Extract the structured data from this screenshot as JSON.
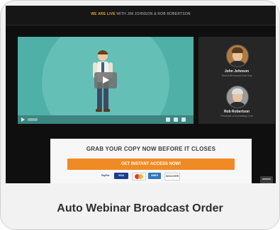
{
  "card": {
    "title": "Auto Webinar Broadcast Order"
  },
  "preview": {
    "topbar": {
      "live_label": "WE ARE LIVE",
      "live_rest": " WITH JIM JOHNSON & ROB ROBERTSON"
    },
    "video": {
      "icon": "play-icon"
    },
    "hosts": [
      {
        "name": "John Johnson",
        "role": "Host & All Around Cool Guy"
      },
      {
        "name": "Rob Robertson",
        "role": "Presenter of Something Cool"
      }
    ],
    "cta": {
      "headline": "GRAB YOUR COPY NOW BEFORE IT CLOSES",
      "button_label": "GET INSTANT ACCESS NOW!",
      "payment_methods": [
        "PayPal",
        "VISA",
        "MasterCard",
        "AMEX",
        "DISCOVER"
      ]
    }
  },
  "colors": {
    "accent": "#f08a24",
    "video_bg": "#4fb0a8",
    "live": "#e9a42a"
  }
}
